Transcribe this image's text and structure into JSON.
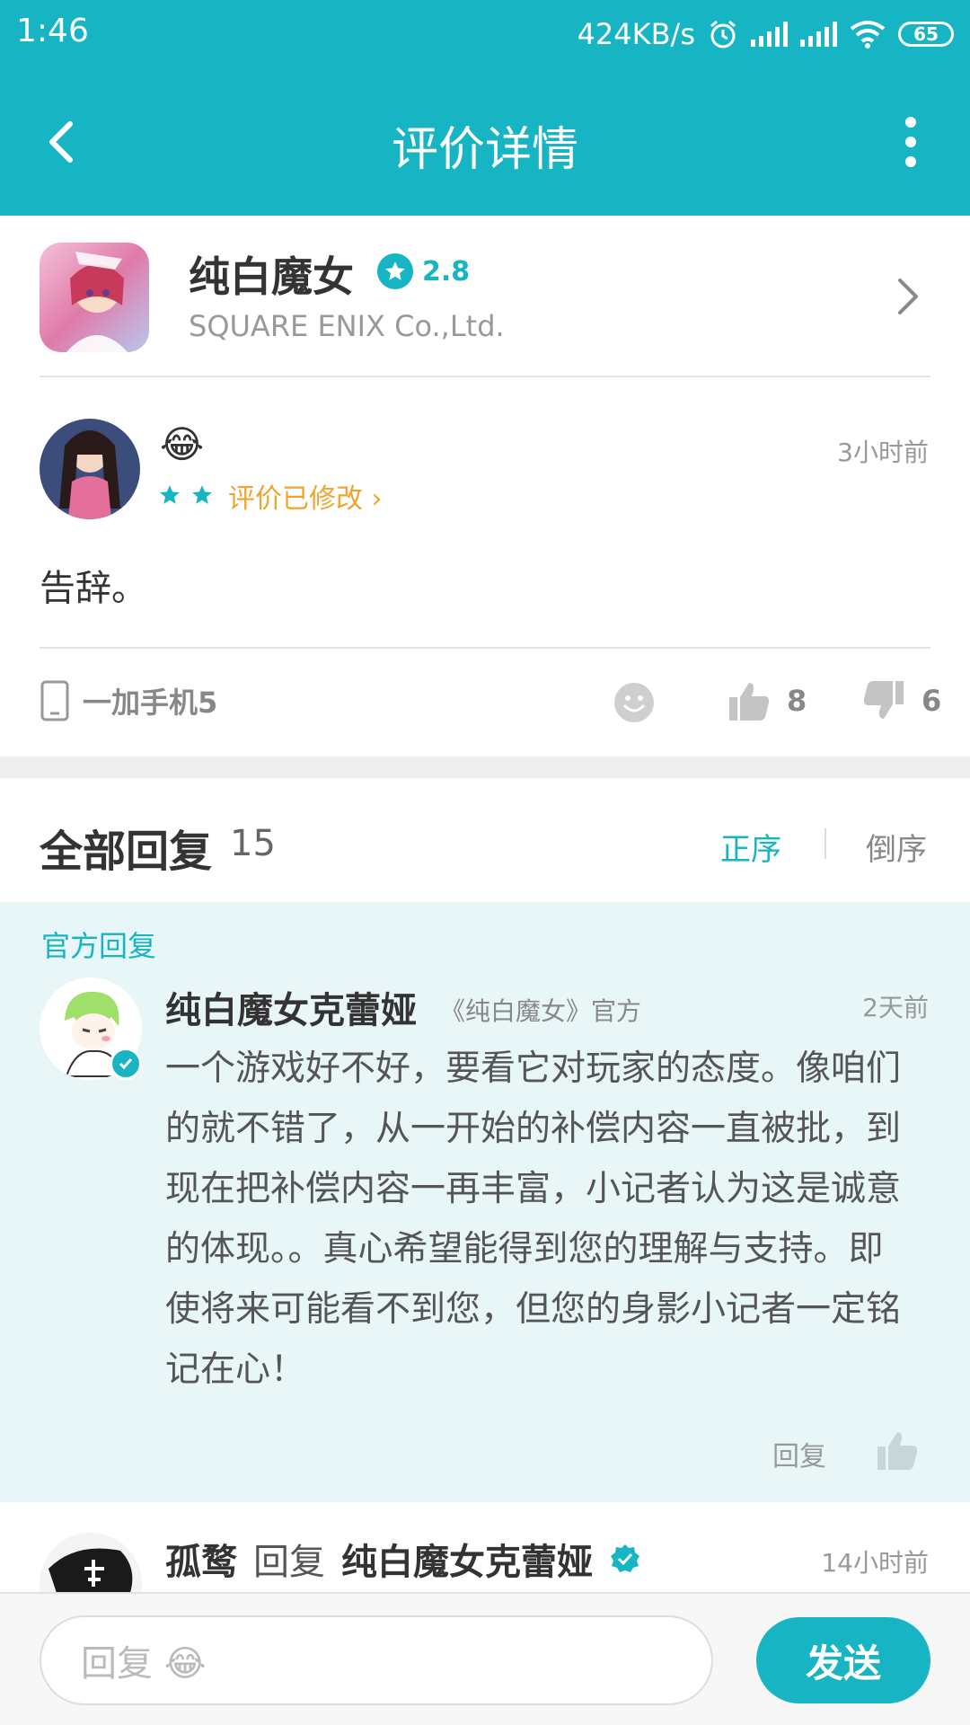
{
  "status_bar": {
    "time": "1:46",
    "network_speed": "424KB/s",
    "battery": "65",
    "icons": [
      "alarm-icon",
      "signal-icon",
      "signal-icon",
      "wifi-icon",
      "battery-icon"
    ]
  },
  "header": {
    "title": "评价详情",
    "back_icon": "chevron-left-icon",
    "more_icon": "more-vertical-icon"
  },
  "app": {
    "name": "纯白魔女",
    "rating": "2.8",
    "developer": "SQUARE ENIX Co.,Ltd."
  },
  "review": {
    "emoji": "😂",
    "stars": 2,
    "edited_label": "评价已修改",
    "edited_arrow": "›",
    "time": "3小时前",
    "text": "告辞。",
    "device": "一加手机5",
    "likes": "8",
    "dislikes": "6"
  },
  "replies": {
    "title": "全部回复",
    "count": "15",
    "sort_asc": "正序",
    "sort_desc": "倒序"
  },
  "official_reply": {
    "tag": "官方回复",
    "name": "纯白魔女克蕾娅",
    "subtitle": "《纯白魔女》官方",
    "time": "2天前",
    "text": "一个游戏好不好，要看它对玩家的态度。像咱们的就不错了，从一开始的补偿内容一直被批，到现在把补偿内容一再丰富，小记者认为这是诚意的体现。。真心希望能得到您的理解与支持。即使将来可能看不到您，但您的身影小记者一定铭记在心！",
    "reply_label": "回复"
  },
  "next_reply": {
    "user": "孤鹜",
    "verb": "回复",
    "target": "纯白魔女克蕾娅",
    "time": "14小时前"
  },
  "input_bar": {
    "placeholder": "回复 😂",
    "send_label": "发送"
  },
  "colors": {
    "accent": "#17b5c4",
    "edited": "#f0a42d",
    "official_bg": "#e8f6f8"
  }
}
